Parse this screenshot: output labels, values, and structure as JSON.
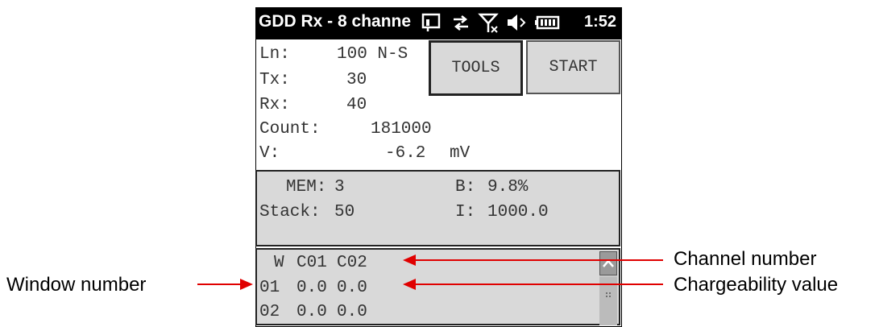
{
  "status_bar": {
    "title": "GDD Rx - 8 channe",
    "time": "1:52",
    "icons": [
      "window-icon",
      "sync-arrows-icon",
      "no-signal-icon",
      "speaker-mute-icon",
      "battery-icon"
    ]
  },
  "info": {
    "ln_label": "Ln:",
    "ln_value": "100 N-S",
    "tx_label": "Tx:",
    "tx_value": "30",
    "rx_label": "Rx:",
    "rx_value": "40",
    "count_label": "Count:",
    "count_value": "181000",
    "v_label": "V:",
    "v_value": "-6.2",
    "v_unit": "mV"
  },
  "buttons": {
    "tools": "TOOLS",
    "start": "START"
  },
  "memory": {
    "mem_label": "MEM:",
    "mem_value": "3",
    "b_label": "B:",
    "b_value": "9.8%",
    "stack_label": "Stack:",
    "stack_value": "50",
    "i_label": "I:",
    "i_value": "1000.0"
  },
  "table": {
    "headers": [
      "W",
      "C01",
      "C02"
    ],
    "rows": [
      [
        "01",
        "0.0",
        "0.0"
      ],
      [
        "02",
        "0.0",
        "0.0"
      ]
    ]
  },
  "annotations": {
    "channel_number": "Channel number",
    "chargeability_value": "Chargeability value",
    "window_number": "Window number",
    "arrow_color": "#e00000"
  }
}
